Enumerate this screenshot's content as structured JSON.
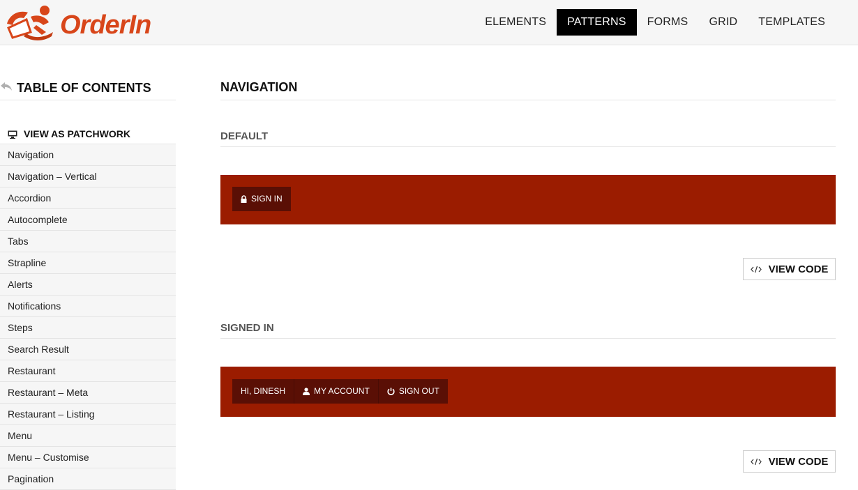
{
  "brand": {
    "name": "OrderIn"
  },
  "nav": [
    {
      "label": "ELEMENTS",
      "active": false
    },
    {
      "label": "PATTERNS",
      "active": true
    },
    {
      "label": "FORMS",
      "active": false
    },
    {
      "label": "GRID",
      "active": false
    },
    {
      "label": "TEMPLATES",
      "active": false
    }
  ],
  "sidebar": {
    "title": "TABLE OF CONTENTS",
    "patchwork_label": "VIEW AS PATCHWORK",
    "items": [
      "Navigation",
      "Navigation – Vertical",
      "Accordion",
      "Autocomplete",
      "Tabs",
      "Strapline",
      "Alerts",
      "Notifications",
      "Steps",
      "Search Result",
      "Restaurant",
      "Restaurant – Meta",
      "Restaurant – Listing",
      "Menu",
      "Menu – Customise",
      "Pagination"
    ]
  },
  "main": {
    "title": "NAVIGATION",
    "default": {
      "heading": "DEFAULT",
      "sign_in": "SIGN IN",
      "view_code": "VIEW CODE"
    },
    "signed_in": {
      "heading": "SIGNED IN",
      "greeting": "HI, DINESH",
      "my_account": "MY ACCOUNT",
      "sign_out": "SIGN OUT",
      "view_code": "VIEW CODE"
    }
  },
  "colors": {
    "brand": "#d8461a",
    "demo_bar": "#9b1c00",
    "pill_bg": "#5a0f05",
    "nav_active": "#000000"
  },
  "icons": {
    "toc_back": "reply-arrow-icon",
    "patchwork": "monitor-icon",
    "sign_in": "lock-icon",
    "my_account": "user-icon",
    "sign_out": "power-icon",
    "view_code": "code-icon"
  }
}
